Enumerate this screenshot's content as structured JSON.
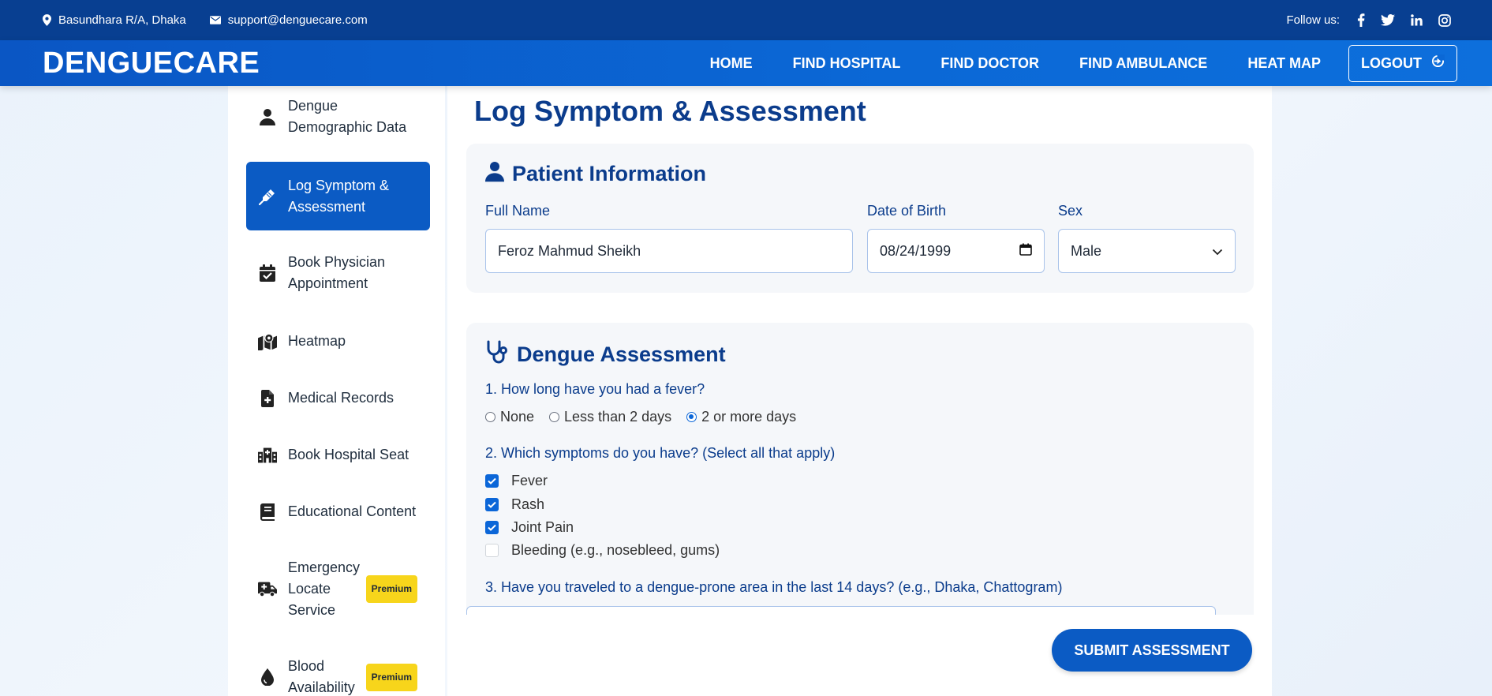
{
  "topbar": {
    "address": "Basundhara R/A, Dhaka",
    "email": "support@denguecare.com",
    "follow_label": "Follow us:"
  },
  "nav": {
    "logo": "DENGUECARE",
    "links": [
      "HOME",
      "FIND HOSPITAL",
      "FIND DOCTOR",
      "FIND AMBULANCE",
      "HEAT MAP"
    ],
    "logout": "LOGOUT"
  },
  "sidebar": {
    "items": [
      {
        "label": "Dengue Demographic Data",
        "icon": "user-icon"
      },
      {
        "label": "Log Symptom & Assessment",
        "icon": "thermometer-icon",
        "active": true
      },
      {
        "label": "Book Physician Appointment",
        "icon": "calendar-check-icon"
      },
      {
        "label": "Heatmap",
        "icon": "map-marker-icon"
      },
      {
        "label": "Medical Records",
        "icon": "file-medical-icon"
      },
      {
        "label": "Book Hospital Seat",
        "icon": "hospital-icon"
      },
      {
        "label": "Educational Content",
        "icon": "book-icon"
      },
      {
        "label": "Emergency Locate Service",
        "icon": "ambulance-icon",
        "badge": "Premium"
      },
      {
        "label": "Blood Availability",
        "icon": "blood-drop-icon",
        "badge": "Premium"
      }
    ]
  },
  "main": {
    "title": "Log Symptom & Assessment",
    "patient": {
      "title": "Patient Information",
      "full_name_label": "Full Name",
      "full_name": "Feroz Mahmud Sheikh",
      "dob_label": "Date of Birth",
      "dob": "08/24/1999",
      "sex_label": "Sex",
      "sex": "Male"
    },
    "assessment": {
      "title": "Dengue Assessment",
      "q1": "1. How long have you had a fever?",
      "q1_options": [
        "None",
        "Less than 2 days",
        "2 or more days"
      ],
      "q1_selected": "2 or more days",
      "q2": "2. Which symptoms do you have? (Select all that apply)",
      "q2_options": [
        {
          "label": "Fever",
          "checked": true
        },
        {
          "label": "Rash",
          "checked": true
        },
        {
          "label": "Joint Pain",
          "checked": true
        },
        {
          "label": "Bleeding (e.g., nosebleed, gums)",
          "checked": false
        }
      ],
      "q3": "3. Have you traveled to a dengue-prone area in the last 14 days? (e.g., Dhaka, Chattogram)"
    },
    "submit": "SUBMIT ASSESSMENT"
  },
  "colors": {
    "topbar": "#083f91",
    "navbar": "#0b68d6",
    "accent": "#0b5bc4",
    "heading": "#0b3c8c",
    "premium": "#f7d51b"
  }
}
